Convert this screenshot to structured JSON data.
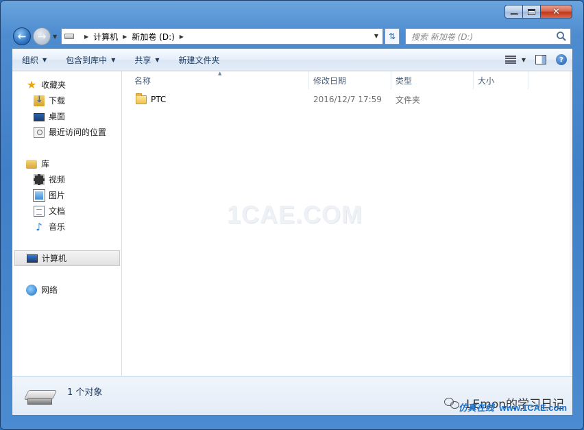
{
  "window": {
    "caption": {
      "minimize": "minimize",
      "maximize": "maximize",
      "close": "close"
    }
  },
  "address_bar": {
    "crumbs": [
      "计算机",
      "新加卷 (D:)"
    ],
    "search_placeholder": "搜索 新加卷 (D:)"
  },
  "toolbar": {
    "organize": "组织",
    "include_in_library": "包含到库中",
    "share": "共享",
    "new_folder": "新建文件夹"
  },
  "sidebar": {
    "favorites": {
      "label": "收藏夹",
      "items": [
        {
          "label": "下载",
          "icon": "download-folder-icon"
        },
        {
          "label": "桌面",
          "icon": "desktop-icon"
        },
        {
          "label": "最近访问的位置",
          "icon": "recent-places-icon"
        }
      ]
    },
    "libraries": {
      "label": "库",
      "items": [
        {
          "label": "视频",
          "icon": "video-library-icon"
        },
        {
          "label": "图片",
          "icon": "pictures-library-icon"
        },
        {
          "label": "文档",
          "icon": "documents-library-icon"
        },
        {
          "label": "音乐",
          "icon": "music-library-icon"
        }
      ]
    },
    "computer": {
      "label": "计算机"
    },
    "network": {
      "label": "网络"
    }
  },
  "file_list": {
    "columns": {
      "name": "名称",
      "date": "修改日期",
      "type": "类型",
      "size": "大小"
    },
    "rows": [
      {
        "name": "PTC",
        "date": "2016/12/7 17:59",
        "type": "文件夹",
        "size": ""
      }
    ],
    "watermark": "1CAE.COM"
  },
  "details_pane": {
    "status": "1 个对象",
    "watermark_text": "LEmon的学习日记",
    "brand_cn": "仿真在线",
    "brand_url": "www.1CAE.com"
  },
  "colors": {
    "frame": "#4b8bd0",
    "accent": "#1e395b",
    "close": "#c2391d"
  }
}
